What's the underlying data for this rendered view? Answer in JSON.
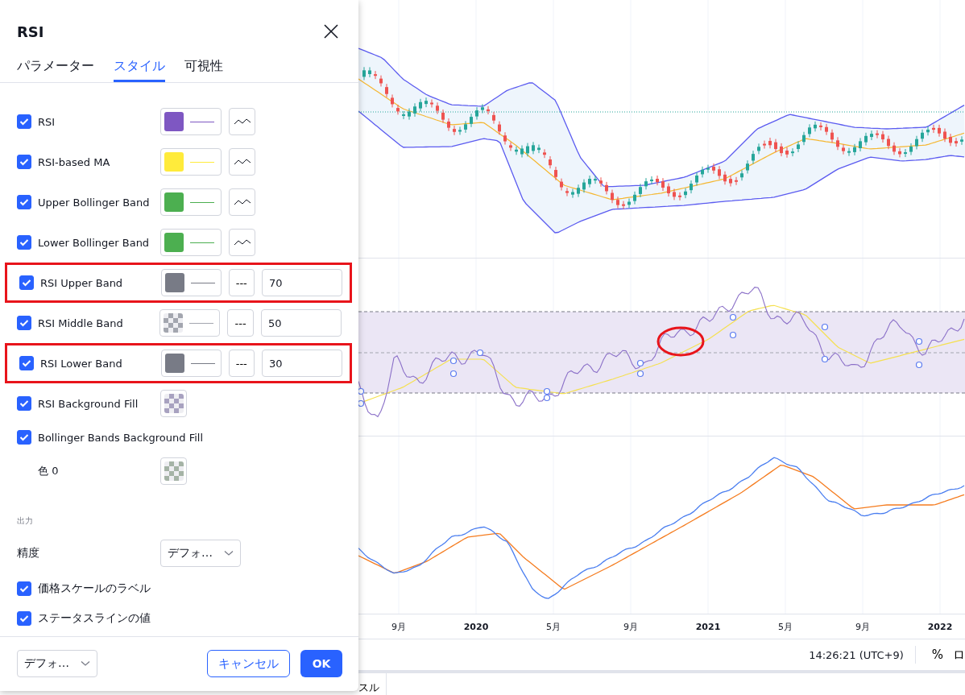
{
  "dialog": {
    "title": "RSI",
    "tabs": [
      {
        "label": "パラメーター",
        "selected": false
      },
      {
        "label": "スタイル",
        "selected": true
      },
      {
        "label": "可視性",
        "selected": false
      }
    ],
    "style_rows": [
      {
        "kind": "line",
        "label": "RSI",
        "checked": true,
        "color": "#7e57c2",
        "highlighted": false
      },
      {
        "kind": "line",
        "label": "RSI-based MA",
        "checked": true,
        "color": "#ffeb3b",
        "highlighted": false
      },
      {
        "kind": "line",
        "label": "Upper Bollinger Band",
        "checked": true,
        "color": "#4caf50",
        "highlighted": false
      },
      {
        "kind": "line",
        "label": "Lower Bollinger Band",
        "checked": true,
        "color": "#4caf50",
        "highlighted": false
      },
      {
        "kind": "band",
        "label": "RSI Upper Band",
        "checked": true,
        "color": "#787b86",
        "checkered": false,
        "dash": "---",
        "value": "70",
        "highlighted": true
      },
      {
        "kind": "band",
        "label": "RSI Middle Band",
        "checked": true,
        "color": "#a3a6af",
        "checkered": true,
        "dash": "---",
        "value": "50",
        "highlighted": false
      },
      {
        "kind": "band",
        "label": "RSI Lower Band",
        "checked": true,
        "color": "#787b86",
        "checkered": false,
        "dash": "---",
        "value": "30",
        "highlighted": true
      },
      {
        "kind": "fill",
        "label": "RSI Background Fill",
        "checked": true,
        "color": "#a8a2c0",
        "highlighted": false
      },
      {
        "kind": "group",
        "label": "Bollinger Bands Background Fill",
        "checked": true,
        "highlighted": false
      },
      {
        "kind": "color",
        "label": "色 0",
        "color": "#a5b3a6",
        "highlighted": false
      }
    ],
    "section_label": "出力",
    "precision": {
      "label": "精度",
      "value": "デフォ…"
    },
    "output_checks": [
      {
        "label": "価格スケールのラベル",
        "checked": true
      },
      {
        "label": "ステータスラインの値",
        "checked": true
      }
    ],
    "footer": {
      "template_value": "デフォ…",
      "cancel": "キャンセル",
      "ok": "OK"
    }
  },
  "chart": {
    "time_axis": [
      {
        "label": "9月",
        "kind": "month"
      },
      {
        "label": "2020",
        "kind": "year"
      },
      {
        "label": "5月",
        "kind": "month"
      },
      {
        "label": "9月",
        "kind": "month"
      },
      {
        "label": "2021",
        "kind": "year"
      },
      {
        "label": "5月",
        "kind": "month"
      },
      {
        "label": "9月",
        "kind": "month"
      },
      {
        "label": "2022",
        "kind": "year"
      }
    ],
    "time_readout": "14:26:21 (UTC+9)",
    "percent": "%",
    "log": "ロ",
    "bottom_tab": "スル"
  }
}
